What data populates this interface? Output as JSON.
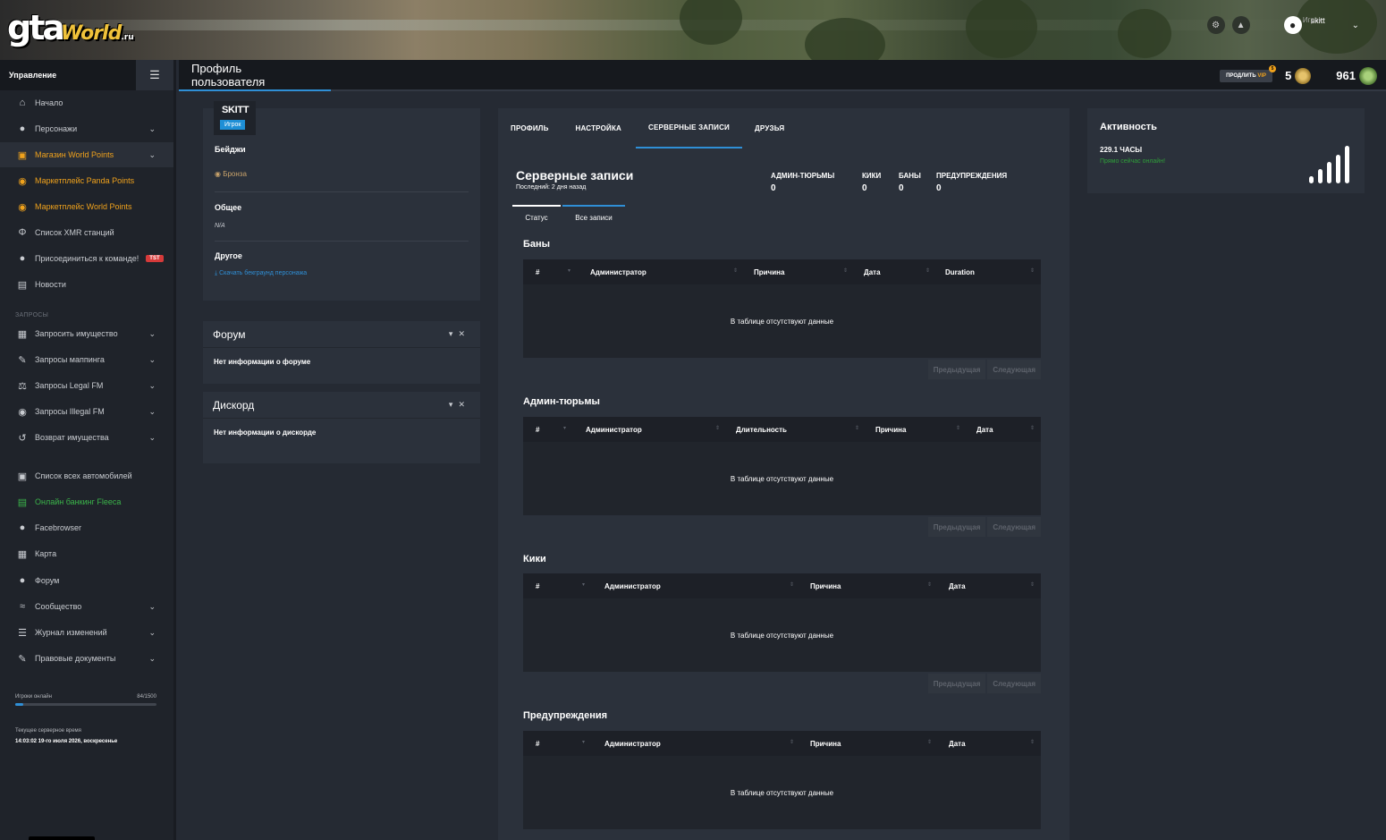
{
  "header": {
    "logo_text": "gta",
    "logo_sub": "World",
    "logo_domain": ".ru",
    "username": "skitt",
    "user_role": "Игрок"
  },
  "sidebar": {
    "title": "Управление",
    "items": [
      {
        "label": "Начало",
        "icon": "home-icon"
      },
      {
        "label": "Персонажи",
        "icon": "user-icon"
      },
      {
        "label": "Магазин World Points",
        "icon": "cart-icon"
      },
      {
        "label": "Маркетплейс Panda Points",
        "icon": "coins-icon"
      },
      {
        "label": "Маркетплейс World Points",
        "icon": "coins-icon"
      },
      {
        "label": "Список XMR станций",
        "icon": "antenna-icon"
      },
      {
        "label": "Присоединиться к команде!",
        "icon": "user-plus-icon",
        "badge": "TST"
      },
      {
        "label": "Новости",
        "icon": "newspaper-icon"
      }
    ],
    "section_requests": "ЗАПРОСЫ",
    "request_items": [
      {
        "label": "Запросить имущество",
        "icon": "building-icon"
      },
      {
        "label": "Запросы маппинга",
        "icon": "brush-icon"
      },
      {
        "label": "Запросы Legal FM",
        "icon": "scale-icon"
      },
      {
        "label": "Запросы Illegal FM",
        "icon": "mask-icon"
      },
      {
        "label": "Возврат имущества",
        "icon": "undo-icon"
      }
    ],
    "other_items": [
      {
        "label": "Список всех автомобилей",
        "icon": "car-icon"
      },
      {
        "label": "Онлайн банкинг Fleeca",
        "icon": "bank-card-icon"
      },
      {
        "label": "Facebrowser",
        "icon": "users-icon"
      },
      {
        "label": "Карта",
        "icon": "map-icon"
      },
      {
        "label": "Форум",
        "icon": "comments-icon"
      },
      {
        "label": "Сообщество",
        "icon": "share-icon"
      },
      {
        "label": "Журнал изменений",
        "icon": "list-icon"
      },
      {
        "label": "Правовые документы",
        "icon": "document-icon"
      }
    ],
    "players_online_label": "Игроки онлайн",
    "players_online_value": "84/1500",
    "players_online_fraction": 0.056,
    "server_time_label": "Текущее серверное время",
    "server_time_value": "14:03:02 19-го июля 2026, воскресенье"
  },
  "subheader": {
    "title": "Профиль пользователя",
    "vip_button": "ПРОДЛИТЬ",
    "vip_word": "VIP",
    "vip_dot": "5",
    "medals_count": "5",
    "coins_count": "961"
  },
  "profile": {
    "name": "SKITT",
    "role": "Игрок",
    "badges_label": "Бейджи",
    "badge_value": "Бронза",
    "general_label": "Общее",
    "general_value": "N/A",
    "other_label": "Другое",
    "download_link": "Скачать бекграунд персонажа"
  },
  "forum_widget": {
    "title": "Форум",
    "body": "Нет информации о форуме"
  },
  "discord_widget": {
    "title": "Дискорд",
    "body": "Нет информации о дискорде"
  },
  "main": {
    "tabs": [
      "ПРОФИЛЬ",
      "НАСТРОЙКА",
      "СЕРВЕРНЫЕ ЗАПИСИ",
      "ДРУЗЬЯ"
    ],
    "records_title": "Серверные записи",
    "records_last": "Последний: 2 дня назад",
    "stats": [
      {
        "label": "АДМИН-ТЮРЬМЫ",
        "value": "0"
      },
      {
        "label": "КИКИ",
        "value": "0"
      },
      {
        "label": "БАНЫ",
        "value": "0"
      },
      {
        "label": "ПРЕДУПРЕЖДЕНИЯ",
        "value": "0"
      }
    ],
    "subtabs": [
      "Статус",
      "Все записи"
    ],
    "empty_text": "В таблице отсутствуют данные",
    "prev": "Предыдущая",
    "next": "Следующая",
    "sections": [
      {
        "title": "Баны",
        "columns": [
          "#",
          "Администратор",
          "Причина",
          "Дата",
          "Duration"
        ]
      },
      {
        "title": "Админ-тюрьмы",
        "columns": [
          "#",
          "Администратор",
          "Длительность",
          "Причина",
          "Дата"
        ]
      },
      {
        "title": "Кики",
        "columns": [
          "#",
          "Администратор",
          "Причина",
          "Дата"
        ]
      },
      {
        "title": "Предупреждения",
        "columns": [
          "#",
          "Администратор",
          "Причина",
          "Дата"
        ]
      }
    ]
  },
  "activity": {
    "title": "Активность",
    "hours": "229.1 ЧАСЫ",
    "status": "Прямо сейчас онлайн!"
  }
}
